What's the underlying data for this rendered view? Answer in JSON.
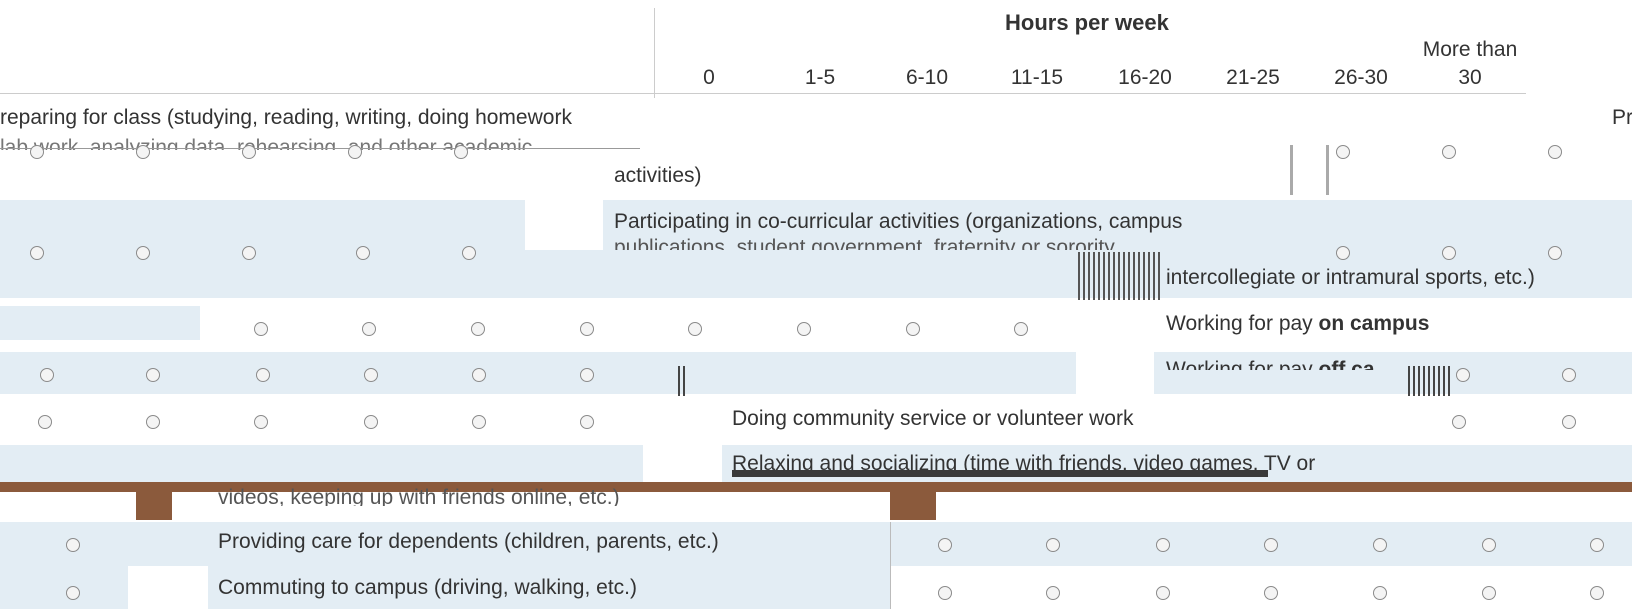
{
  "header": {
    "title": "Hours per week",
    "columns": [
      "0",
      "1-5",
      "6-10",
      "11-15",
      "16-20",
      "21-25",
      "26-30",
      "More than",
      "30"
    ]
  },
  "rows": [
    {
      "text_a": "reparing for class (studying, reading, writing, doing homework",
      "text_b": "activities)",
      "right_cut": "Pr"
    },
    {
      "text_a": "Participating in co-curricular activities (organizations, campus",
      "text_b": "publications, student government, fraternity or sorority,",
      "text_c": "intercollegiate or intramural sports, etc.)"
    },
    {
      "text_pre": "Working for pay",
      "text_bold": "on campus"
    },
    {
      "text_pre": "Working for pay",
      "text_bold": "off ca"
    },
    {
      "text_a": "Doing community service or volunteer work"
    },
    {
      "text_a": "Relaxing and socializing (time with friends, video games, TV or"
    },
    {
      "text_a": "videos, keeping up with friends online, etc.)"
    },
    {
      "text_a": "Providing care for dependents (children, parents, etc.)"
    },
    {
      "text_a": "Commuting to campus (driving, walking, etc.)"
    }
  ],
  "colors": {
    "band": "#e3edf4",
    "glitch": "#8b5a3c",
    "border": "#cccccc"
  }
}
